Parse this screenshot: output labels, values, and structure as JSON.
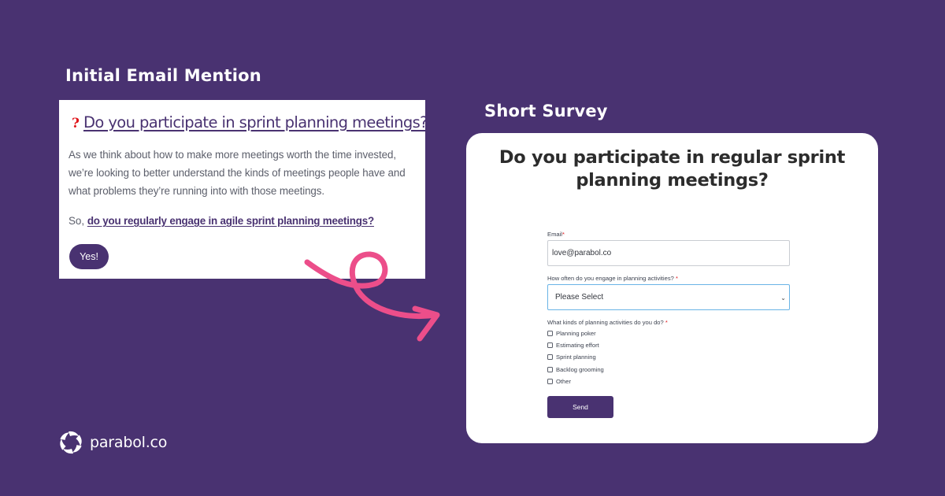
{
  "colors": {
    "background": "#493271",
    "accent_pink": "#ec4e8a",
    "required_red": "#e0161b",
    "focus_blue": "#6ab4e6"
  },
  "sections": {
    "email_title": "Initial Email Mention",
    "survey_title": "Short Survey"
  },
  "email": {
    "question_icon": "?",
    "heading": "Do you participate in sprint planning meetings?",
    "body": "As we think about how to make more meetings worth the time invested, we’re looking to better understand the kinds of meetings people have and what problems they’re running into with those meetings.",
    "cta_prefix": "So, ",
    "cta_link": "do you regularly engage in agile sprint planning meetings?",
    "yes_button": "Yes!"
  },
  "survey": {
    "question": "Do you participate in regular sprint planning meetings?",
    "email_label": "Email",
    "required_mark": "*",
    "email_value": "love@parabol.co",
    "frequency_label": "How often do you engage in planning activities?",
    "frequency_selected": "Please Select",
    "activities_label": "What kinds of planning activities do you do?",
    "activities": [
      {
        "label": "Planning poker",
        "checked": false
      },
      {
        "label": "Estimating effort",
        "checked": false
      },
      {
        "label": "Sprint planning",
        "checked": false
      },
      {
        "label": "Backlog grooming",
        "checked": false
      },
      {
        "label": "Other",
        "checked": false
      }
    ],
    "send_button": "Send"
  },
  "brand": {
    "logo_icon": "parabol-logo-icon",
    "name": "parabol.co"
  }
}
